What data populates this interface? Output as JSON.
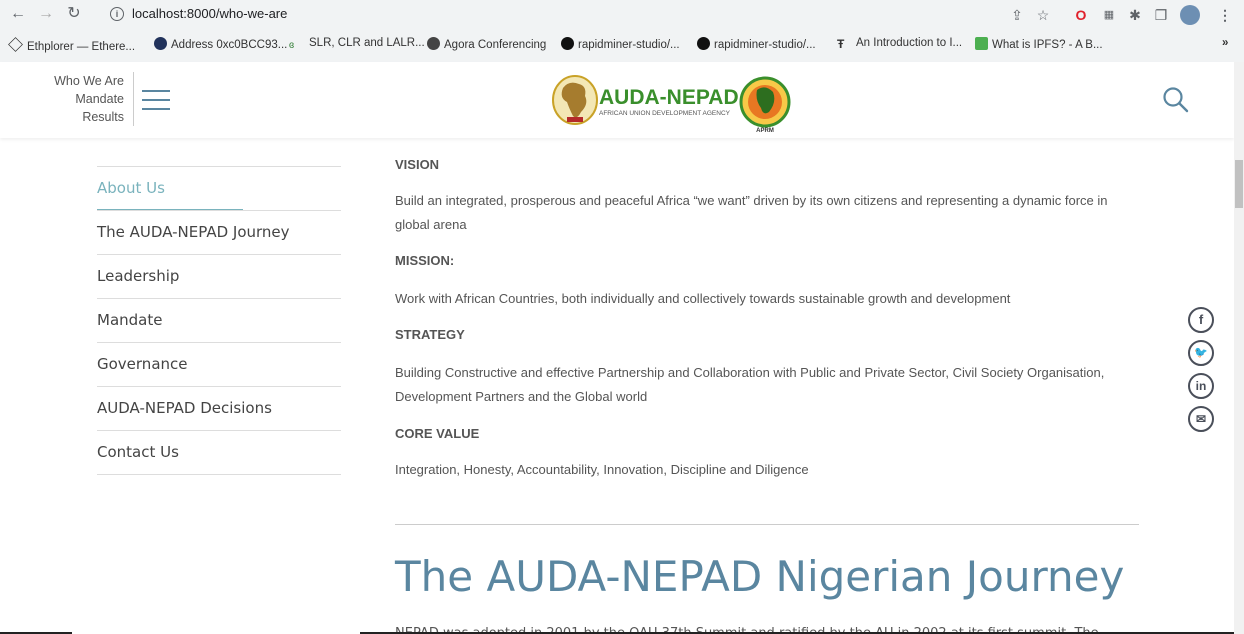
{
  "browser": {
    "url": "localhost:8000/who-we-are",
    "bookmarks": [
      {
        "label": "Ethplorer — Ethere...",
        "color": "#333"
      },
      {
        "label": "Address 0xc0BCC93...",
        "color": "#21325b"
      },
      {
        "label": "SLR, CLR and LALR...",
        "color": "#2e7d32"
      },
      {
        "label": "Agora Conferencing",
        "color": "#333"
      },
      {
        "label": "rapidminer-studio/...",
        "color": "#111"
      },
      {
        "label": "rapidminer-studio/...",
        "color": "#111"
      },
      {
        "label": "An Introduction to I...",
        "color": "#333"
      },
      {
        "label": "What is IPFS? - A B...",
        "color": "#4caf50"
      }
    ],
    "overflow": "»"
  },
  "header": {
    "quick_links": [
      "Who We Are",
      "Mandate",
      "Results"
    ],
    "logo_text": "AUDA-NEPAD",
    "logo_sub": "AFRICAN UNION DEVELOPMENT AGENCY",
    "seal_top": "AFRICAN PEER REVIEW MECHANISM",
    "seal_bottom": "APRM"
  },
  "sidebar": {
    "items": [
      {
        "label": "About Us",
        "active": true
      },
      {
        "label": "The AUDA-NEPAD Journey",
        "active": false
      },
      {
        "label": "Leadership",
        "active": false
      },
      {
        "label": "Mandate",
        "active": false
      },
      {
        "label": "Governance",
        "active": false
      },
      {
        "label": "AUDA-NEPAD Decisions",
        "active": false
      },
      {
        "label": "Contact Us",
        "active": false
      }
    ]
  },
  "content": {
    "vision_heading": "VISION",
    "vision_text": "Build an integrated, prosperous and peaceful Africa “we want” driven by its own citizens and representing a dynamic force in global arena",
    "mission_heading": "MISSION:",
    "mission_text": "Work with African Countries, both individually and collectively towards sustainable growth and development",
    "strategy_heading": "STRATEGY",
    "strategy_text": "Building Constructive and effective Partnership and Collaboration with Public and Private Sector, Civil Society Organisation, Development Partners and the Global world",
    "core_heading": "CORE VALUE",
    "core_text": "Integration, Honesty, Accountability, Innovation, Discipline and Diligence",
    "journey_title": "The AUDA-NEPAD Nigerian Journey",
    "journey_text": "NEPAD was adopted in 2001 by the OAU 37th Summit and ratified by the AU in 2002 at its first summit. The"
  },
  "social": {
    "facebook": "f",
    "twitter": "🐦",
    "linkedin": "in",
    "email": "✉"
  },
  "colors": {
    "accent": "#7ab3bd",
    "title": "#5a86a0",
    "logo_green": "#3a8f2c",
    "logo_orange": "#e87722"
  }
}
